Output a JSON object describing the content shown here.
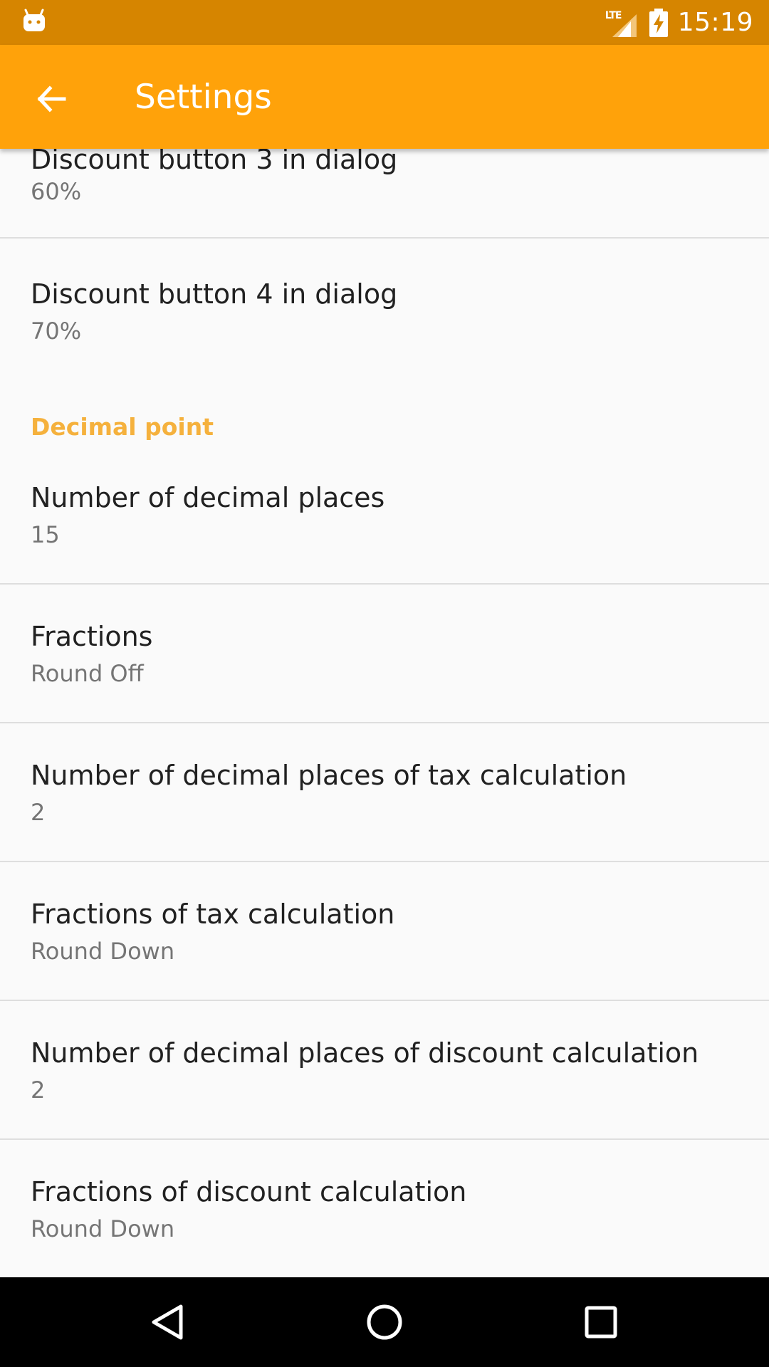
{
  "status_bar": {
    "time": "15:19",
    "network_label": "LTE",
    "icons": [
      "android-icon",
      "lte-signal-icon",
      "battery-charging-icon"
    ]
  },
  "app_bar": {
    "title": "Settings",
    "back_icon": "arrow-back-icon",
    "background_color": "#ffa20a"
  },
  "settings": {
    "partial_item": {
      "title": "Discount button 3 in dialog",
      "summary": "60%"
    },
    "discount_button_4": {
      "title": "Discount button 4 in dialog",
      "summary": "70%"
    },
    "category_decimal_point": "Decimal point",
    "decimal_places": {
      "title": "Number of decimal places",
      "summary": "15"
    },
    "fractions": {
      "title": "Fractions",
      "summary": "Round Off"
    },
    "tax_decimal_places": {
      "title": "Number of decimal places of tax calculation",
      "summary": "2"
    },
    "tax_fractions": {
      "title": "Fractions of tax calculation",
      "summary": "Round Down"
    },
    "discount_decimal_places": {
      "title": "Number of decimal places of discount calculation",
      "summary": "2"
    },
    "discount_fractions": {
      "title": "Fractions of discount calculation",
      "summary": "Round Down"
    }
  },
  "nav_bar": {
    "icons": [
      "back-triangle-icon",
      "home-circle-icon",
      "recents-square-icon"
    ]
  },
  "colors": {
    "status_bar": "#d68500",
    "accent": "#f5b13d"
  }
}
